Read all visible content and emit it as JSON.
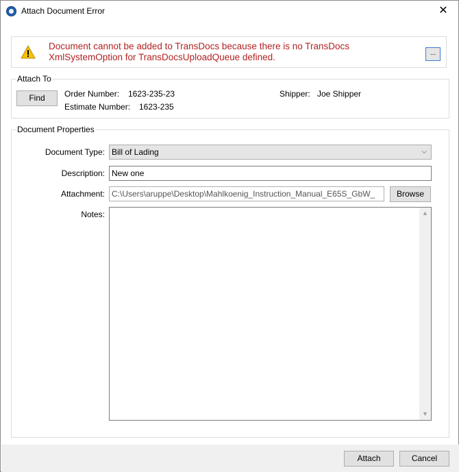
{
  "window": {
    "title": "Attach Document Error",
    "close_glyph": "✕"
  },
  "error": {
    "icon": "warning-icon",
    "message": "Document cannot be added to TransDocs because there is no TransDocs XmlSystemOption for TransDocsUploadQueue defined.",
    "message_color": "#b22222",
    "more_label": "..."
  },
  "attach_to": {
    "legend": "Attach To",
    "find_label": "Find",
    "order_number_label": "Order Number:",
    "order_number_value": "1623-235-23",
    "estimate_number_label": "Estimate Number:",
    "estimate_number_value": "1623-235",
    "shipper_label": "Shipper:",
    "shipper_value": "Joe Shipper"
  },
  "document_properties": {
    "legend": "Document Properties",
    "document_type_label": "Document Type:",
    "document_type_value": "Bill of Lading",
    "description_label": "Description:",
    "description_value": "New one",
    "attachment_label": "Attachment:",
    "attachment_value": "C:\\Users\\aruppe\\Desktop\\Mahlkoenig_Instruction_Manual_E65S_GbW_",
    "browse_label": "Browse",
    "notes_label": "Notes:",
    "notes_value": ""
  },
  "footer": {
    "attach_label": "Attach",
    "cancel_label": "Cancel"
  }
}
